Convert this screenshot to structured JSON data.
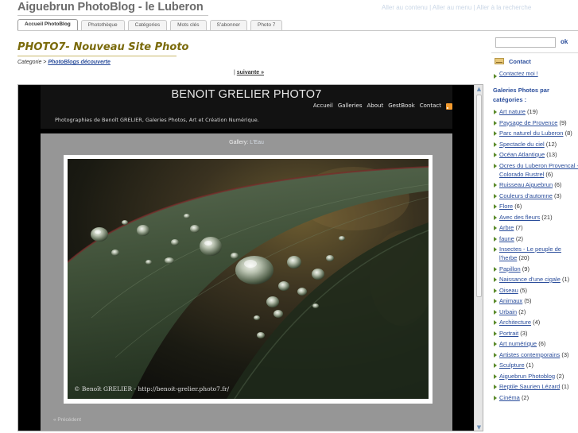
{
  "site": {
    "title": "Aiguebrun PhotoBlog - le Luberon",
    "skip_links": [
      "Aller au contenu",
      "Aller au menu",
      "Aller à la recherche"
    ],
    "skip_sep": "|"
  },
  "tabs": [
    {
      "label": "Accueil PhotoBlog",
      "active": true
    },
    {
      "label": "Photothèque",
      "active": false
    },
    {
      "label": "Catégories",
      "active": false
    },
    {
      "label": "Mots clés",
      "active": false
    },
    {
      "label": "S'abonner",
      "active": false
    },
    {
      "label": "Photo 7",
      "active": false
    }
  ],
  "post": {
    "title": "PHOTO7- Nouveau Site Photo",
    "category_prefix": "Categorie > ",
    "category_link": "PhotoBlogs découverte",
    "next_prefix": "| ",
    "next_link": "suivante »"
  },
  "embedded": {
    "title": "BENOIT GRELIER PHOTO7",
    "nav": [
      "Accueil",
      "Galleries",
      "About",
      "GestBook",
      "Contact"
    ],
    "tagline": "Photographies de Benoît GRELIER, Galeries Photos, Art et Création Numérique.",
    "gallery_prefix": "Gallery: ",
    "gallery_name": "L'Eau",
    "watermark": "© Benoît GRELIER  -  http://benoit-grelier.photo7.fr/",
    "prev": "«  Précédent"
  },
  "sidebar": {
    "search_placeholder": "",
    "search_button": "ok",
    "contact_title": "Contact",
    "contact_link": "Contactez moi !",
    "galleries_title": "Galeries Photos par catégories :",
    "categories": [
      {
        "name": "Art nature",
        "count": "(19)"
      },
      {
        "name": "Paysage de Provence",
        "count": "(9)"
      },
      {
        "name": "Parc naturel du Luberon",
        "count": "(8)"
      },
      {
        "name": "Spectacle du ciel",
        "count": "(12)"
      },
      {
        "name": "Océan Atlantique",
        "count": "(13)"
      },
      {
        "name": "Ocres du Luberon Provencal - Colorado Rustrel",
        "count": "(6)"
      },
      {
        "name": "Ruisseau Aiguebrun",
        "count": "(6)"
      },
      {
        "name": "Couleurs d'automne",
        "count": "(3)"
      },
      {
        "name": "Flore",
        "count": "(6)"
      },
      {
        "name": "Avec des fleurs",
        "count": "(21)"
      },
      {
        "name": "Arbre",
        "count": "(7)"
      },
      {
        "name": "faune",
        "count": "(2)"
      },
      {
        "name": "Insectes - Le peuple de l'herbe",
        "count": "(20)"
      },
      {
        "name": "Papillon",
        "count": "(9)"
      },
      {
        "name": "Naissance d'une cigale",
        "count": "(1)"
      },
      {
        "name": "Oiseau",
        "count": "(5)"
      },
      {
        "name": "Animaux",
        "count": "(5)"
      },
      {
        "name": "Urbain",
        "count": "(2)"
      },
      {
        "name": "Architecture",
        "count": "(4)"
      },
      {
        "name": "Portrait",
        "count": "(3)"
      },
      {
        "name": "Art numérique",
        "count": "(6)"
      },
      {
        "name": "Artistes contemporains",
        "count": "(3)"
      },
      {
        "name": "Sculpture",
        "count": "(1)"
      },
      {
        "name": "Aiguebrun Photoblog",
        "count": "(2)"
      },
      {
        "name": "Reptile Saurien Lézard",
        "count": "(1)"
      },
      {
        "name": "Cinéma",
        "count": "(2)"
      }
    ]
  },
  "colors": {
    "title_gold": "#7a6a0a",
    "link_blue": "#2a4d9b",
    "bullet_green": "#5a8a2a",
    "rss_orange": "#f29a2e"
  }
}
